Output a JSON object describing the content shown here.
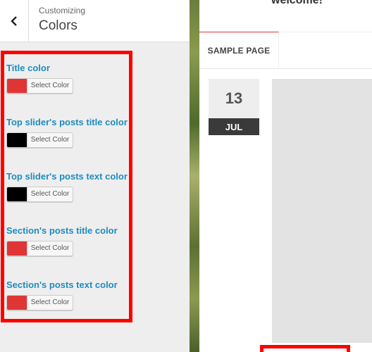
{
  "sidebar": {
    "breadcrumb": "Customizing",
    "title": "Colors",
    "controls": [
      {
        "label": "Title color",
        "color": "#e03535",
        "button": "Select Color"
      },
      {
        "label": "Top slider's posts title color",
        "color": "#000000",
        "button": "Select Color"
      },
      {
        "label": "Top slider's posts text color",
        "color": "#000000",
        "button": "Select Color"
      },
      {
        "label": "Section's posts title color",
        "color": "#e03535",
        "button": "Select Color"
      },
      {
        "label": "Section's posts text color",
        "color": "#e03535",
        "button": "Select Color"
      }
    ]
  },
  "preview": {
    "welcome": "welcome!",
    "nav": [
      "SAMPLE PAGE"
    ],
    "date": {
      "day": "13",
      "month": "JUL"
    }
  },
  "colors": {
    "accent_red": "#e03535",
    "highlight_red": "#ff0000",
    "label_blue": "#1e8cbe"
  },
  "icons": {
    "back": "chevron-left-icon"
  }
}
